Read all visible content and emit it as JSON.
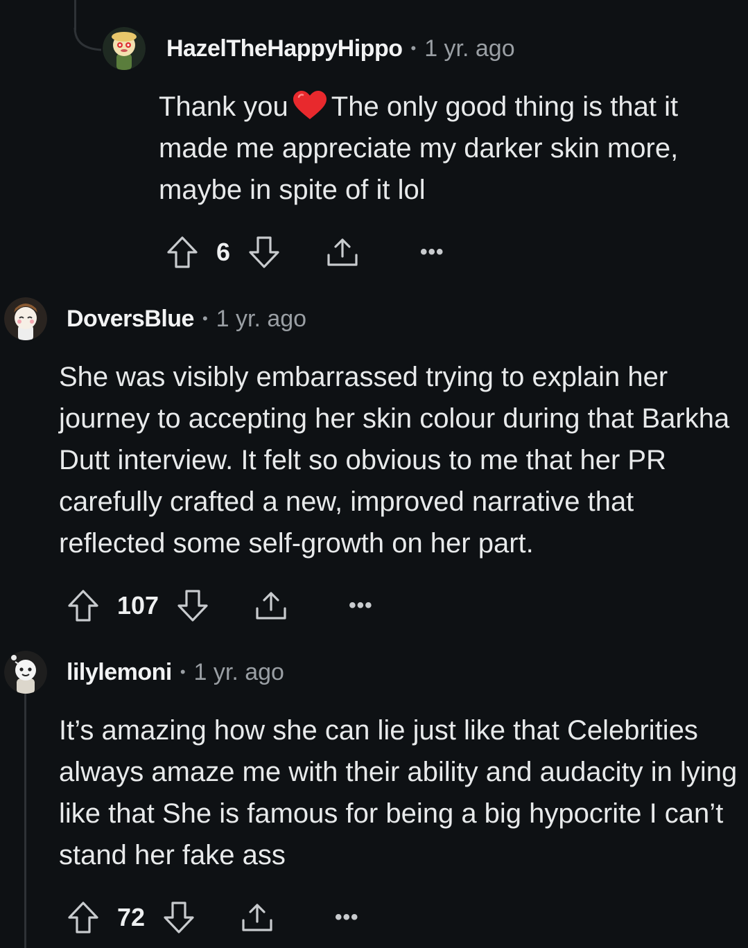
{
  "comments": [
    {
      "author": "HazelTheHappyHippo",
      "separator": "•",
      "time": "1 yr. ago",
      "body_before_heart": "Thank you",
      "heart_icon": "red-heart-emoji",
      "body_after_heart": "The only good thing is that it made me appreciate my darker skin more, maybe in spite of it lol",
      "score": "6",
      "more": "•••"
    },
    {
      "author": "DoversBlue",
      "separator": "•",
      "time": "1 yr. ago",
      "body": "She was visibly embarrassed trying to explain her journey to accepting her skin colour during that Barkha Dutt interview. It felt so obvious to me that her PR carefully crafted a new, improved narrative that reflected some self-growth on her part.",
      "score": "107",
      "more": "•••"
    },
    {
      "author": "lilylemoni",
      "separator": "•",
      "time": "1 yr. ago",
      "body": "It’s amazing how she can lie just like that Celebrities always amaze me with their ability and audacity in lying like that She is famous for being a big hypocrite I can’t stand her fake ass",
      "score": "72",
      "more": "•••"
    }
  ],
  "icons": {
    "upvote": "upvote-arrow-icon",
    "downvote": "downvote-arrow-icon",
    "share": "share-icon",
    "more": "more-options-icon"
  },
  "colors": {
    "background": "#0e1114",
    "text": "#e8eaeb",
    "muted": "#9a9fa4",
    "heart": "#e8292d"
  }
}
